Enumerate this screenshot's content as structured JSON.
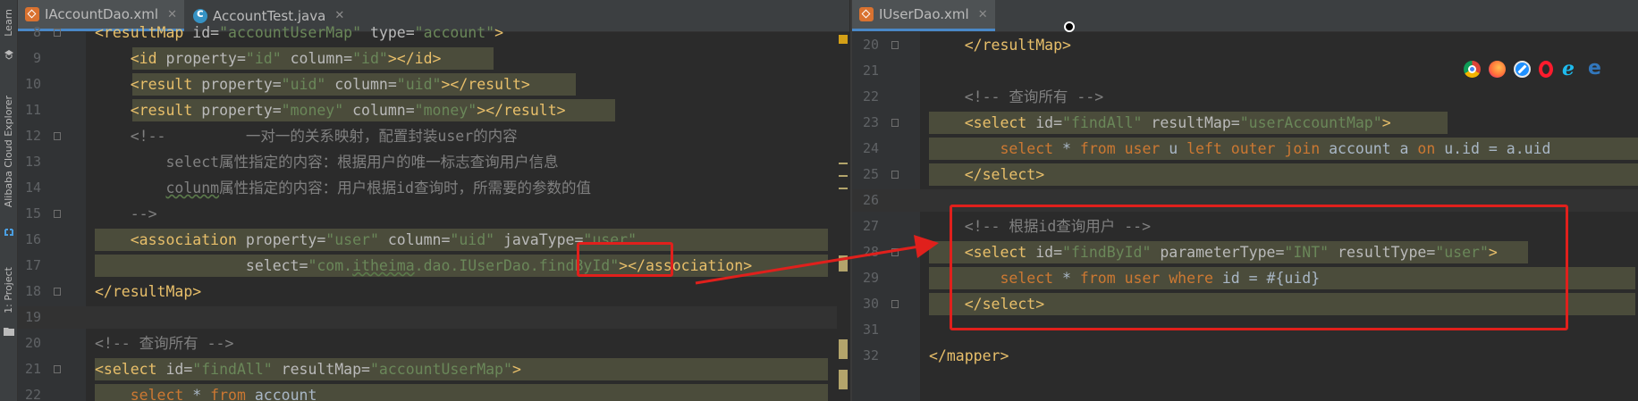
{
  "sidebar": {
    "learn": "Learn",
    "cloud": "Alibaba Cloud Explorer",
    "project": "1: Project"
  },
  "left": {
    "tabs": [
      {
        "label": "IAccountDao.xml",
        "icon": "xml-file-icon"
      },
      {
        "label": "AccountTest.java",
        "icon": "java-class-icon"
      }
    ],
    "lines": [
      {
        "n": "8",
        "html": "<span class=t>&lt;resultMap </span><span class=a>id=</span><span class=v>\"accountUserMap\" </span><span class=a>type=</span><span class=v>\"account\"</span><span class=t>&gt;</span>"
      },
      {
        "n": "9",
        "html": "    <span class=t>&lt;id </span><span class=a>property=</span><span class=v>\"id\" </span><span class=a>column=</span><span class=v>\"id\"</span><span class=t>&gt;&lt;/id&gt;</span>"
      },
      {
        "n": "10",
        "html": "    <span class=t>&lt;result </span><span class=a>property=</span><span class=v>\"uid\" </span><span class=a>column=</span><span class=v>\"uid\"</span><span class=t>&gt;&lt;/result&gt;</span>"
      },
      {
        "n": "11",
        "html": "    <span class=t>&lt;result </span><span class=a>property=</span><span class=v>\"money\" </span><span class=a>column=</span><span class=v>\"money\"</span><span class=t>&gt;&lt;/result&gt;</span>"
      },
      {
        "n": "12",
        "html": "    <span class=c>&lt;!--         一对一的关系映射，配置封装user的内容</span>"
      },
      {
        "n": "13",
        "html": "<span class=c>        select属性指定的内容：根据用户的唯一标志查询用户信息</span>"
      },
      {
        "n": "14",
        "html": "<span class=c>        <span class=wavy>colunm</span>属性指定的内容：用户根据id查询时，所需要的参数的值</span>"
      },
      {
        "n": "15",
        "html": "    <span class=c>--&gt;</span>"
      },
      {
        "n": "16",
        "html": "    <span class=t>&lt;association </span><span class=a>property=</span><span class=v>\"user\" </span><span class=a>column=</span><span class=v>\"uid\" </span><span class=a>javaType=</span><span class=v>\"user\"</span>"
      },
      {
        "n": "17",
        "html": "                 <span class=a>select=</span><span class=v>\"com.<span class=wavy>itheima</span>.dao.IUserDao.findById\"</span><span class=t>&gt;&lt;/association&gt;</span>"
      },
      {
        "n": "18",
        "html": "<span class=t>&lt;/resultMap&gt;</span>"
      },
      {
        "n": "19",
        "html": ""
      },
      {
        "n": "20",
        "html": "<span class=c>&lt;!-- 查询所有 --&gt;</span>"
      },
      {
        "n": "21",
        "html": "<span class=t>&lt;select </span><span class=a>id=</span><span class=v>\"findAll\" </span><span class=a>resultMap=</span><span class=v>\"accountUserMap\"</span><span class=t>&gt;</span>"
      },
      {
        "n": "22",
        "html": "    <span class=kw>select </span><span class=pl>* </span><span class=kw>from </span><span class=pl>account</span>"
      }
    ]
  },
  "right": {
    "tabs": [
      {
        "label": "IUserDao.xml",
        "icon": "xml-file-icon"
      }
    ],
    "lines": [
      {
        "n": "20",
        "html": "    <span class=t>&lt;/resultMap&gt;</span>"
      },
      {
        "n": "21",
        "html": ""
      },
      {
        "n": "22",
        "html": "    <span class=c>&lt;!-- 查询所有 --&gt;</span>"
      },
      {
        "n": "23",
        "html": "    <span class=t>&lt;select </span><span class=a>id=</span><span class=v>\"findAll\" </span><span class=a>resultMap=</span><span class=v>\"userAccountMap\"</span><span class=t>&gt;</span>"
      },
      {
        "n": "24",
        "html": "        <span class=kw>select </span><span class=pl>* </span><span class=kw>from user </span><span class=pl>u </span><span class=kw>left outer join </span><span class=pl>account a </span><span class=kw>on </span><span class=pl>u.id = a.uid</span>"
      },
      {
        "n": "25",
        "html": "    <span class=t>&lt;/select&gt;</span>"
      },
      {
        "n": "26",
        "html": ""
      },
      {
        "n": "27",
        "html": "    <span class=c>&lt;!-- 根据id查询用户 --&gt;</span>"
      },
      {
        "n": "28",
        "html": "    <span class=t>&lt;select </span><span class=a>id=</span><span class=v>\"findById\" </span><span class=a>parameterType=</span><span class=v>\"INT\" </span><span class=a>resultType=</span><span class=v>\"user\"</span><span class=t>&gt;</span>"
      },
      {
        "n": "29",
        "html": "        <span class=kw>select </span><span class=pl>* </span><span class=kw>from user where </span><span class=pl>id = #{uid}</span>"
      },
      {
        "n": "30",
        "html": "    <span class=t>&lt;/select&gt;</span>"
      },
      {
        "n": "31",
        "html": ""
      },
      {
        "n": "32",
        "html": "<span class=t>&lt;/mapper&gt;</span>"
      }
    ]
  },
  "browsers": [
    "chrome-icon",
    "firefox-icon",
    "safari-icon",
    "opera-icon",
    "ie-icon",
    "edge-icon"
  ],
  "colors": {
    "annotation": "#e0201c",
    "background": "#2b2b2b",
    "tag": "#e8bf6a",
    "string": "#6a8759"
  }
}
